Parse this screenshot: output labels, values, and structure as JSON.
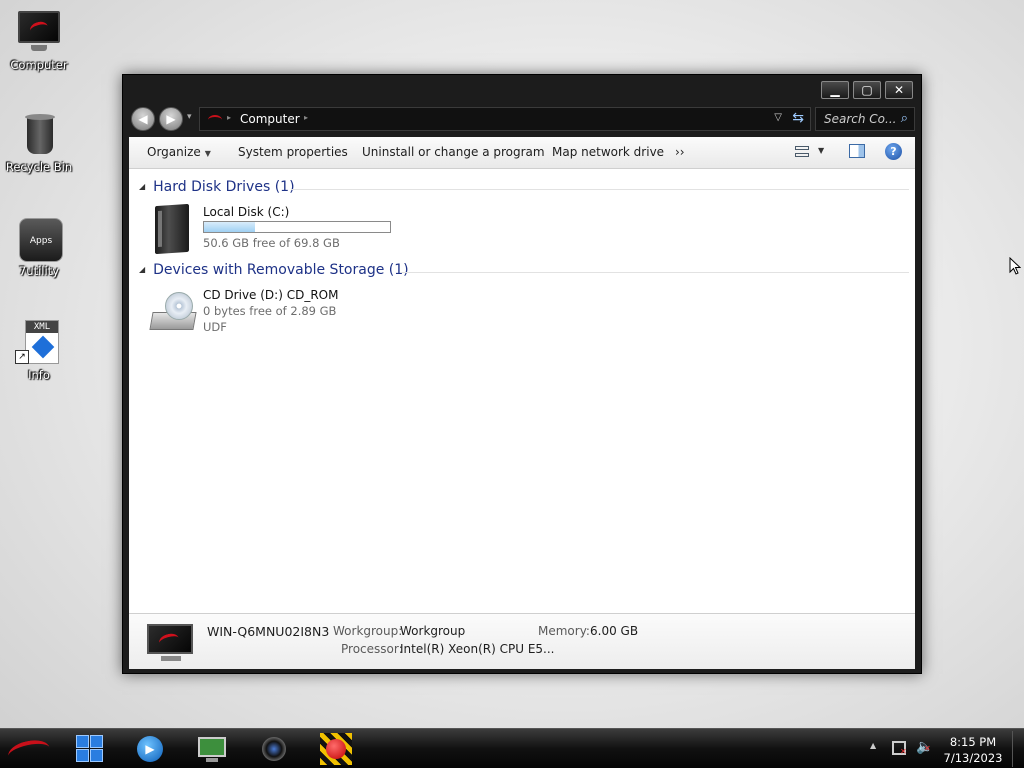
{
  "desktop": {
    "icons": [
      {
        "label": "Computer",
        "icon": "computer-icon"
      },
      {
        "label": "Recycle Bin",
        "icon": "recycle-bin-icon"
      },
      {
        "label": "Apps",
        "icon": "apps-icon"
      },
      {
        "label": "7utility",
        "icon": "7utility-icon"
      },
      {
        "label": "XML",
        "icon": "xml-icon"
      },
      {
        "label": "Info",
        "icon": "info-icon"
      }
    ]
  },
  "window": {
    "caption_buttons": {
      "minimize": "minimize-icon",
      "maximize": "maximize-icon",
      "close": "close-icon"
    },
    "address": {
      "location": "Computer",
      "search_placeholder": "Search Co..."
    },
    "toolbar": {
      "organize": "Organize",
      "system_properties": "System properties",
      "uninstall": "Uninstall or change a program",
      "map_drive": "Map network drive",
      "more": "››"
    },
    "groups": [
      {
        "header": "Hard Disk Drives (1)",
        "items": [
          {
            "name": "Local Disk (C:)",
            "free_text": "50.6 GB free of 69.8 GB",
            "used_fraction": 0.275
          }
        ]
      },
      {
        "header": "Devices with Removable Storage (1)",
        "items": [
          {
            "name": "CD Drive (D:) CD_ROM",
            "free_text": "0 bytes free of 2.89 GB",
            "filesystem": "UDF"
          }
        ]
      }
    ],
    "details": {
      "computer_name": "WIN-Q6MNU02I8N3",
      "workgroup_label": "Workgroup:",
      "workgroup_value": "Workgroup",
      "memory_label": "Memory:",
      "memory_value": "6.00 GB",
      "processor_label": "Processor:",
      "processor_value": "Intel(R) Xeon(R) CPU E5..."
    }
  },
  "taskbar": {
    "apps": [
      "windows-explorer-icon",
      "media-player-icon",
      "remote-desktop-icon",
      "camera-icon",
      "record-icon"
    ],
    "clock": {
      "time": "8:15 PM",
      "date": "7/13/2023"
    }
  },
  "colors": {
    "group_header": "#1e3287",
    "window_chrome": "#1c1c1c",
    "accent_red": "#c8101a"
  }
}
